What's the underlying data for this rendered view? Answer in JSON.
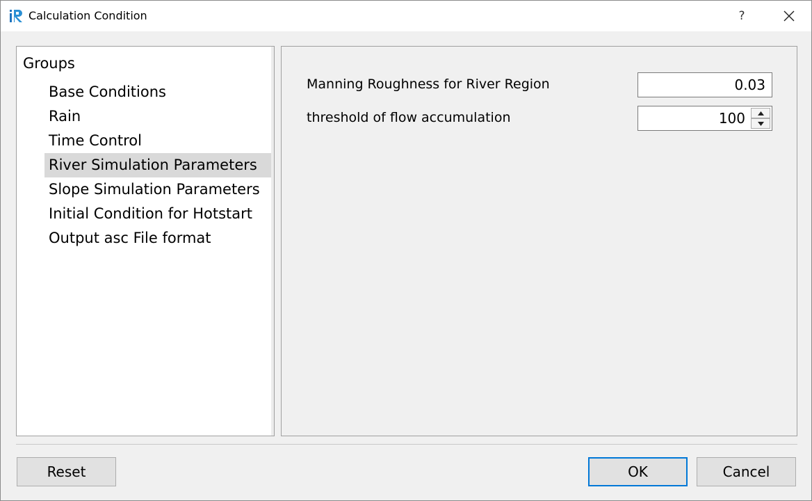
{
  "window": {
    "title": "Calculation Condition",
    "help_label": "?"
  },
  "groups": {
    "header": "Groups",
    "items": [
      {
        "label": "Base Conditions",
        "selected": false
      },
      {
        "label": "Rain",
        "selected": false
      },
      {
        "label": "Time Control",
        "selected": false
      },
      {
        "label": "River Simulation Parameters",
        "selected": true
      },
      {
        "label": "Slope Simulation Parameters",
        "selected": false
      },
      {
        "label": "Initial Condition for Hotstart",
        "selected": false
      },
      {
        "label": "Output asc File format",
        "selected": false
      }
    ]
  },
  "settings": {
    "manning_label": "Manning Roughness for River Region",
    "manning_value": "0.03",
    "threshold_label": "threshold of flow accumulation",
    "threshold_value": "100"
  },
  "buttons": {
    "reset": "Reset",
    "ok": "OK",
    "cancel": "Cancel"
  },
  "colors": {
    "accent": "#0078d7",
    "selection": "#d9d9d9"
  }
}
